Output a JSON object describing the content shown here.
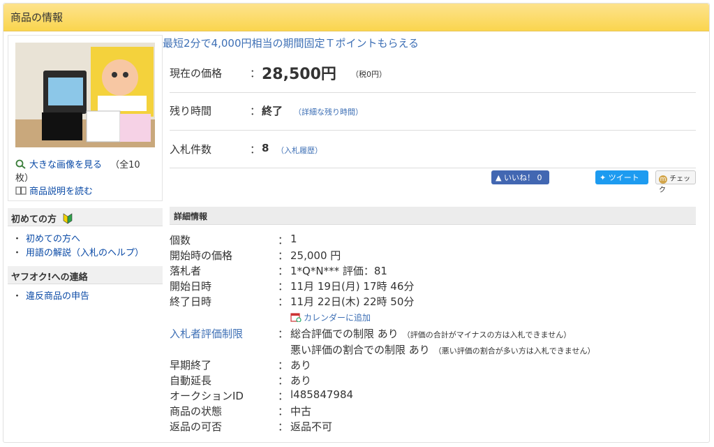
{
  "header": {
    "title": "商品の情報"
  },
  "gallery": {
    "view_large": "大きな画像を見る",
    "image_count_a": "（全10",
    "image_count_b": "枚）",
    "read_description": "商品説明を読む"
  },
  "sidebar": {
    "first_time": {
      "heading": "初めての方",
      "links": [
        "初めての方へ",
        "用語の解説（入札のヘルプ）"
      ]
    },
    "contact": {
      "heading": "ヤフオク!への連絡",
      "links": [
        "違反商品の申告"
      ]
    }
  },
  "promo": "最短2分で4,000円相当の期間固定Ｔポイントもらえる",
  "summary": {
    "price": {
      "label": "現在の価格",
      "colon": "：",
      "value": "28,500円",
      "tax": "（税0円）"
    },
    "remaining": {
      "label": "残り時間",
      "colon": "：",
      "value": "終了",
      "link": "（詳細な残り時間）"
    },
    "bids": {
      "label": "入札件数",
      "colon": "：",
      "value": "8",
      "link": "（入札履歴）"
    }
  },
  "social": {
    "like": "いいね！ 0",
    "tweet": "ツイート",
    "check": "チェック"
  },
  "details": {
    "heading": "詳細情報",
    "colon": "：",
    "quantity": {
      "label": "個数",
      "value": "1"
    },
    "start_price": {
      "label": "開始時の価格",
      "value": "25,000 円"
    },
    "winner": {
      "label": "落札者",
      "value": "1*Q*N*** 評価：81"
    },
    "start_date": {
      "label": "開始日時",
      "value": "11月 19日(月) 17時 46分"
    },
    "end_date": {
      "label": "終了日時",
      "value": "11月 22日(木) 22時 50分"
    },
    "calendar": "カレンダーに追加",
    "rating_limit": {
      "label": "入札者評価制限",
      "line1": "総合評価での制限 あり",
      "note1": "（評価の合計がマイナスの方は入札できません）",
      "line2": "悪い評価の割合での制限 あり",
      "note2": "（悪い評価の割合が多い方は入札できません）"
    },
    "early_end": {
      "label": "早期終了",
      "value": "あり"
    },
    "auto_extend": {
      "label": "自動延長",
      "value": "あり"
    },
    "auction_id": {
      "label": "オークションID",
      "value": "l485847984"
    },
    "condition": {
      "label": "商品の状態",
      "value": "中古"
    },
    "returns": {
      "label": "返品の可否",
      "value": "返品不可"
    }
  },
  "colors": {
    "header_bg": "#fad54e",
    "link": "#0a4aa6",
    "accent_link": "#3d6fb5",
    "like_bg": "#4267b2",
    "tweet_bg": "#1d9bf0"
  }
}
